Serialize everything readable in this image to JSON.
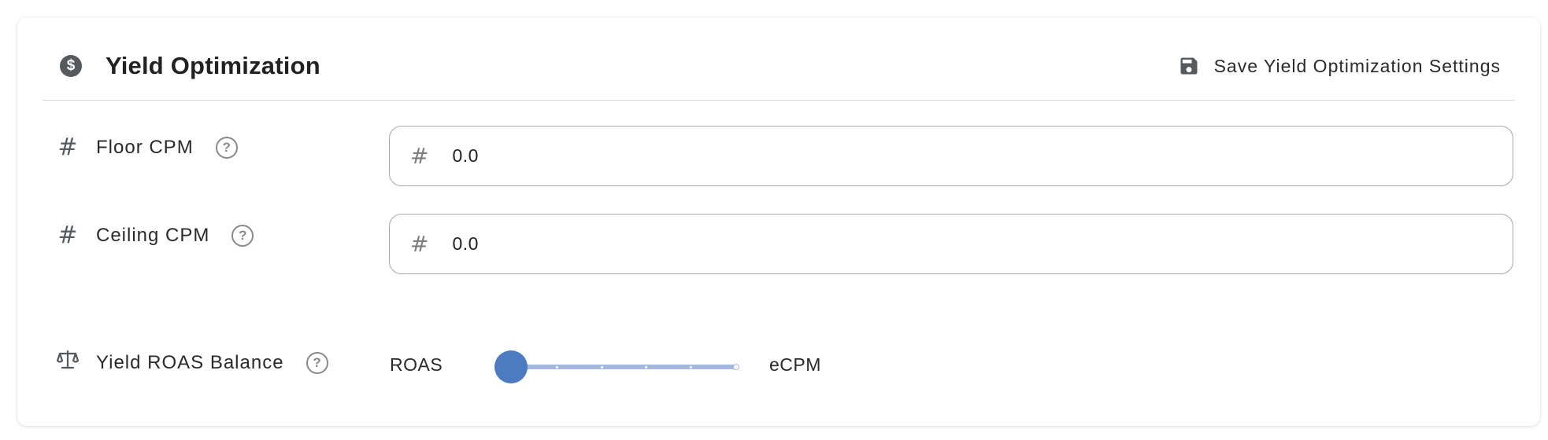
{
  "header": {
    "title": "Yield Optimization",
    "title_icon": "dollar-circle-icon",
    "title_icon_glyph": "$",
    "save_label": "Save Yield Optimization Settings",
    "save_icon": "floppy-disk-icon"
  },
  "fields": {
    "floor_cpm": {
      "label": "Floor CPM",
      "icon": "hash-icon",
      "icon_glyph": "#",
      "prefix": "#",
      "value": "0.0",
      "help_glyph": "?"
    },
    "ceiling_cpm": {
      "label": "Ceiling CPM",
      "icon": "hash-icon",
      "icon_glyph": "#",
      "prefix": "#",
      "value": "0.0",
      "help_glyph": "?"
    },
    "roas_balance": {
      "label": "Yield ROAS Balance",
      "icon": "balance-scale-icon",
      "help_glyph": "?",
      "left_label": "ROAS",
      "right_label": "eCPM",
      "value_fraction": 0.0,
      "steps": 5
    }
  },
  "colors": {
    "accent": "#4c7bc2",
    "track": "#a3b9dc",
    "icon": "#555a5f",
    "border": "#a8a8a8"
  }
}
